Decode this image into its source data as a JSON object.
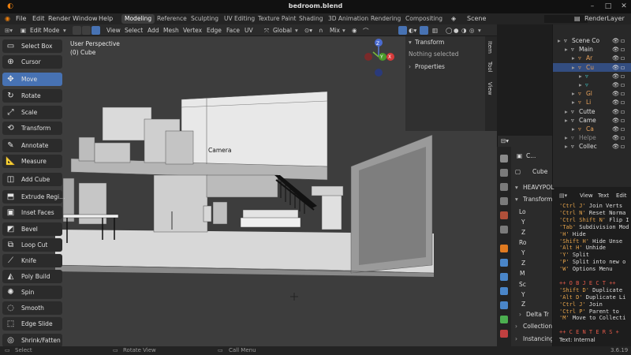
{
  "window": {
    "title": "bedroom.blend"
  },
  "menu": {
    "items": [
      "File",
      "Edit",
      "Render",
      "Window",
      "Help"
    ],
    "workspaces": [
      "Modeling",
      "Reference",
      "Sculpting",
      "UV Editing",
      "Texture Paint",
      "Shading",
      "3D Animation",
      "Rendering",
      "Compositing"
    ],
    "active_workspace": "Modeling",
    "scene": "Scene",
    "view_layer": "RenderLayer"
  },
  "viewport_header": {
    "mode": "Edit Mode",
    "menus": [
      "View",
      "Select",
      "Add",
      "Mesh",
      "Vertex",
      "Edge",
      "Face",
      "UV"
    ],
    "orientation": "Global",
    "pivot": "Mix",
    "view_menu": "View"
  },
  "viewport": {
    "perspective": "User Perspective",
    "object": "(0) Cube",
    "camera_label": "Camera",
    "gizmo": {
      "z": "Z",
      "y": "Y",
      "x": "X"
    }
  },
  "toolbar": {
    "tools": [
      {
        "label": "Select Box",
        "icon": "select-box-icon",
        "active": false
      },
      {
        "label": "Cursor",
        "icon": "cursor-icon",
        "active": false
      },
      {
        "label": "Move",
        "icon": "move-icon",
        "active": true
      },
      {
        "label": "Rotate",
        "icon": "rotate-icon",
        "active": false
      },
      {
        "label": "Scale",
        "icon": "scale-icon",
        "active": false
      },
      {
        "label": "Transform",
        "icon": "transform-icon",
        "active": false
      },
      {
        "label": "Annotate",
        "icon": "annotate-icon",
        "active": false
      },
      {
        "label": "Measure",
        "icon": "measure-icon",
        "active": false
      },
      {
        "label": "Add Cube",
        "icon": "add-cube-icon",
        "active": false
      },
      {
        "label": "Extrude Regi...",
        "icon": "extrude-icon",
        "active": false
      },
      {
        "label": "Inset Faces",
        "icon": "inset-icon",
        "active": false
      },
      {
        "label": "Bevel",
        "icon": "bevel-icon",
        "active": false
      },
      {
        "label": "Loop Cut",
        "icon": "loop-cut-icon",
        "active": false
      },
      {
        "label": "Knife",
        "icon": "knife-icon",
        "active": false
      },
      {
        "label": "Poly Build",
        "icon": "poly-build-icon",
        "active": false
      },
      {
        "label": "Spin",
        "icon": "spin-icon",
        "active": false
      },
      {
        "label": "Smooth",
        "icon": "smooth-icon",
        "active": false
      },
      {
        "label": "Edge Slide",
        "icon": "edge-slide-icon",
        "active": false
      },
      {
        "label": "Shrink/Fatten",
        "icon": "shrink-icon",
        "active": false
      }
    ]
  },
  "npanel": {
    "transform_label": "Transform",
    "nothing_selected": "Nothing selected",
    "properties_label": "Properties",
    "tabs": [
      "Item",
      "Tool",
      "View"
    ]
  },
  "properties": {
    "object_short": "C...",
    "mesh_name": "Cube",
    "modifier": "HEAVYPOL",
    "transform": "Transform",
    "rows": [
      "Lo",
      "Y",
      "Z",
      "Ro",
      "Y",
      "Z",
      "M",
      "Sc",
      "Y",
      "Z"
    ],
    "delta": "Delta Tr",
    "collection": "Collection",
    "instancing": "Instancing"
  },
  "outliner": {
    "rows": [
      {
        "label": "Scene Co",
        "indent": 0,
        "color": "#ddd"
      },
      {
        "label": "Main",
        "indent": 1,
        "color": "#ddd"
      },
      {
        "label": "Ar",
        "indent": 2,
        "color": "#e8a15a"
      },
      {
        "label": "Cu",
        "indent": 2,
        "color": "#e8a15a"
      },
      {
        "label": "",
        "indent": 3,
        "color": "#4cc"
      },
      {
        "label": "",
        "indent": 3,
        "color": "#4cc"
      },
      {
        "label": "Gl",
        "indent": 2,
        "color": "#e8a15a"
      },
      {
        "label": "Li",
        "indent": 2,
        "color": "#e8a15a"
      },
      {
        "label": "Cutte",
        "indent": 1,
        "color": "#ddd"
      },
      {
        "label": "Came",
        "indent": 1,
        "color": "#ddd"
      },
      {
        "label": "Ca",
        "indent": 2,
        "color": "#e8a15a"
      },
      {
        "label": "Helpe",
        "indent": 1,
        "color": "#888"
      },
      {
        "label": "Collec",
        "indent": 1,
        "color": "#ddd"
      }
    ]
  },
  "text_editor": {
    "menus": [
      "View",
      "Text",
      "Edit"
    ],
    "lines": [
      {
        "key": "'Ctrl J'",
        "text": "  Join Verts",
        "kind": "entry"
      },
      {
        "key": "'Ctrl N'",
        "text": " Reset Norma",
        "kind": "entry"
      },
      {
        "key": "'Ctrl Shift N'",
        "text": " Flip I",
        "kind": "entry"
      },
      {
        "key": "'Tab'",
        "text": " Subdivision Mod",
        "kind": "entry"
      },
      {
        "key": "'H'",
        "text": "  Hide",
        "kind": "entry"
      },
      {
        "key": "'Shift H'",
        "text": "  Hide Unse",
        "kind": "entry"
      },
      {
        "key": "'Alt H'",
        "text": "  Unhide",
        "kind": "entry"
      },
      {
        "key": "'Y'",
        "text": " Split",
        "kind": "entry"
      },
      {
        "key": "'P'",
        "text": " Split into new o",
        "kind": "entry"
      },
      {
        "key": "'W'",
        "text": " Options Menu",
        "kind": "entry"
      },
      {
        "key": "",
        "text": "",
        "kind": "blank"
      },
      {
        "key": "",
        "text": "++ O B J E C T ++",
        "kind": "heading"
      },
      {
        "key": "'Shift D'",
        "text": " Duplicate",
        "kind": "entry"
      },
      {
        "key": "'Alt D'",
        "text": " Duplicate Li",
        "kind": "entry"
      },
      {
        "key": "'Ctrl J'",
        "text": " Join",
        "kind": "entry"
      },
      {
        "key": "'Ctrl P'",
        "text": " Parent to",
        "kind": "entry"
      },
      {
        "key": "'M'",
        "text": " Move to Collecti",
        "kind": "entry"
      },
      {
        "key": "",
        "text": "",
        "kind": "blank"
      },
      {
        "key": "",
        "text": "++ C E N T E R S +",
        "kind": "heading"
      }
    ],
    "footer": "Text: Internal"
  },
  "status": {
    "left": "Select",
    "mid": "Rotate View",
    "right": "Call Menu",
    "version": "3.6.19"
  },
  "colors": {
    "accent": "#4772b3",
    "active_tool": "#4772b3"
  }
}
